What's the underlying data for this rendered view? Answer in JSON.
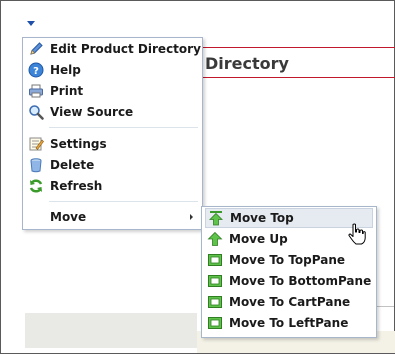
{
  "background": {
    "module_title": "Directory"
  },
  "context_menu": {
    "items": [
      {
        "label": "Edit Product Directory",
        "icon": "pencil-icon"
      },
      {
        "label": "Help",
        "icon": "help-icon"
      },
      {
        "label": "Print",
        "icon": "printer-icon"
      },
      {
        "label": "View Source",
        "icon": "magnifier-icon"
      },
      {
        "label": "Settings",
        "icon": "settings-icon"
      },
      {
        "label": "Delete",
        "icon": "trash-icon"
      },
      {
        "label": "Refresh",
        "icon": "refresh-icon"
      },
      {
        "label": "Move",
        "icon": "none",
        "has_submenu": true
      }
    ]
  },
  "move_submenu": {
    "items": [
      {
        "label": "Move Top",
        "icon": "move-top-icon",
        "hovered": true
      },
      {
        "label": "Move Up",
        "icon": "move-up-icon"
      },
      {
        "label": "Move To TopPane",
        "icon": "pane-icon"
      },
      {
        "label": "Move To BottomPane",
        "icon": "pane-icon"
      },
      {
        "label": "Move To CartPane",
        "icon": "pane-icon"
      },
      {
        "label": "Move To LeftPane",
        "icon": "pane-icon"
      }
    ]
  },
  "colors": {
    "accent_red": "#c2182b",
    "menu_border": "#a8b6cc",
    "hover_bg": "#e6ebf1",
    "icon_green": "#3a9a2a"
  }
}
